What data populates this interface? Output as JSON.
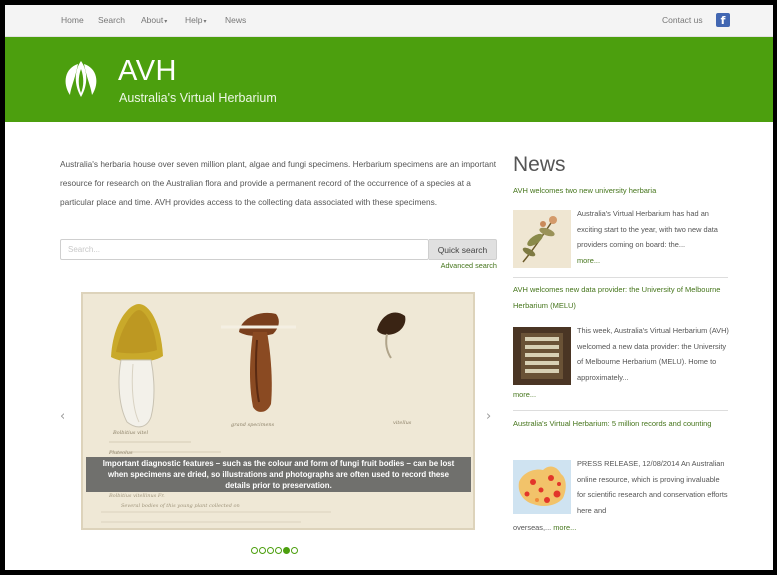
{
  "topnav": {
    "items": [
      {
        "label": "Home",
        "caret": ""
      },
      {
        "label": "Search",
        "caret": ""
      },
      {
        "label": "About",
        "caret": "▾"
      },
      {
        "label": "Help",
        "caret": "▾"
      },
      {
        "label": "News",
        "caret": ""
      }
    ],
    "contact": "Contact us",
    "facebook_glyph": "f",
    "facebook_icon": "facebook-icon"
  },
  "banner": {
    "title": "AVH",
    "subtitle": "Australia's Virtual Herbarium",
    "logo_icon": "avh-leaf-logo",
    "background": "#4c9f0e"
  },
  "intro": {
    "text": "Australia's herbaria house over seven million plant, algae and fungi specimens. Herbarium specimens are an important resource for research on the Australian flora and provide a permanent record of the occurrence of a species at a particular place and time. AVH provides access to the collecting data associated with these specimens."
  },
  "search": {
    "placeholder": "Search...",
    "button_label": "Quick search",
    "advanced_link": "Advanced search"
  },
  "carousel": {
    "caption": "Important diagnostic features – such as the colour and form of fungi fruit bodies – can be lost when specimens are dried, so illustrations and photographs are often used to record these details prior to preservation.",
    "prev_glyph": "‹",
    "next_glyph": "›",
    "slide_count": 6,
    "active_slide": 5,
    "illustration_labels": [
      "Bolbitius vitel",
      "grand specimens",
      "vitellus",
      "Pluteolus"
    ],
    "handwritten_lines": [
      "Bolbitius vitellinus Fr.",
      "Several bodies of this young plant collected on"
    ]
  },
  "news": {
    "heading": "News",
    "articles": [
      {
        "title": "AVH welcomes two new university herbaria",
        "summary": "Australia's Virtual Herbarium has had an exciting start to the year, with two new data providers coming on board: the...",
        "summary_after": "",
        "more": "more...",
        "thumb_icon": "pressed-plant-thumbnail"
      },
      {
        "title": "AVH welcomes new data provider: the University of Melbourne Herbarium (MELU)",
        "summary": "This week, Australia's Virtual Herbarium (AVH) welcomed a new data provider: the University of Melbourne Herbarium (MELU). Home to approximately...",
        "summary_after": "",
        "more": "more...",
        "thumb_icon": "herbarium-cabinet-thumbnail"
      },
      {
        "title": "Australia's Virtual Herbarium: 5 million records and counting",
        "summary": "PRESS RELEASE, 12/08/2014 An Australian online resource, which is proving invaluable for scientific research and conservation efforts here and",
        "summary_after": "overseas,...",
        "more": "more...",
        "thumb_icon": "australia-map-thumbnail"
      }
    ]
  },
  "colors": {
    "brand_green": "#4c9f0e",
    "link_green": "#45751b",
    "body_text": "#555555"
  }
}
